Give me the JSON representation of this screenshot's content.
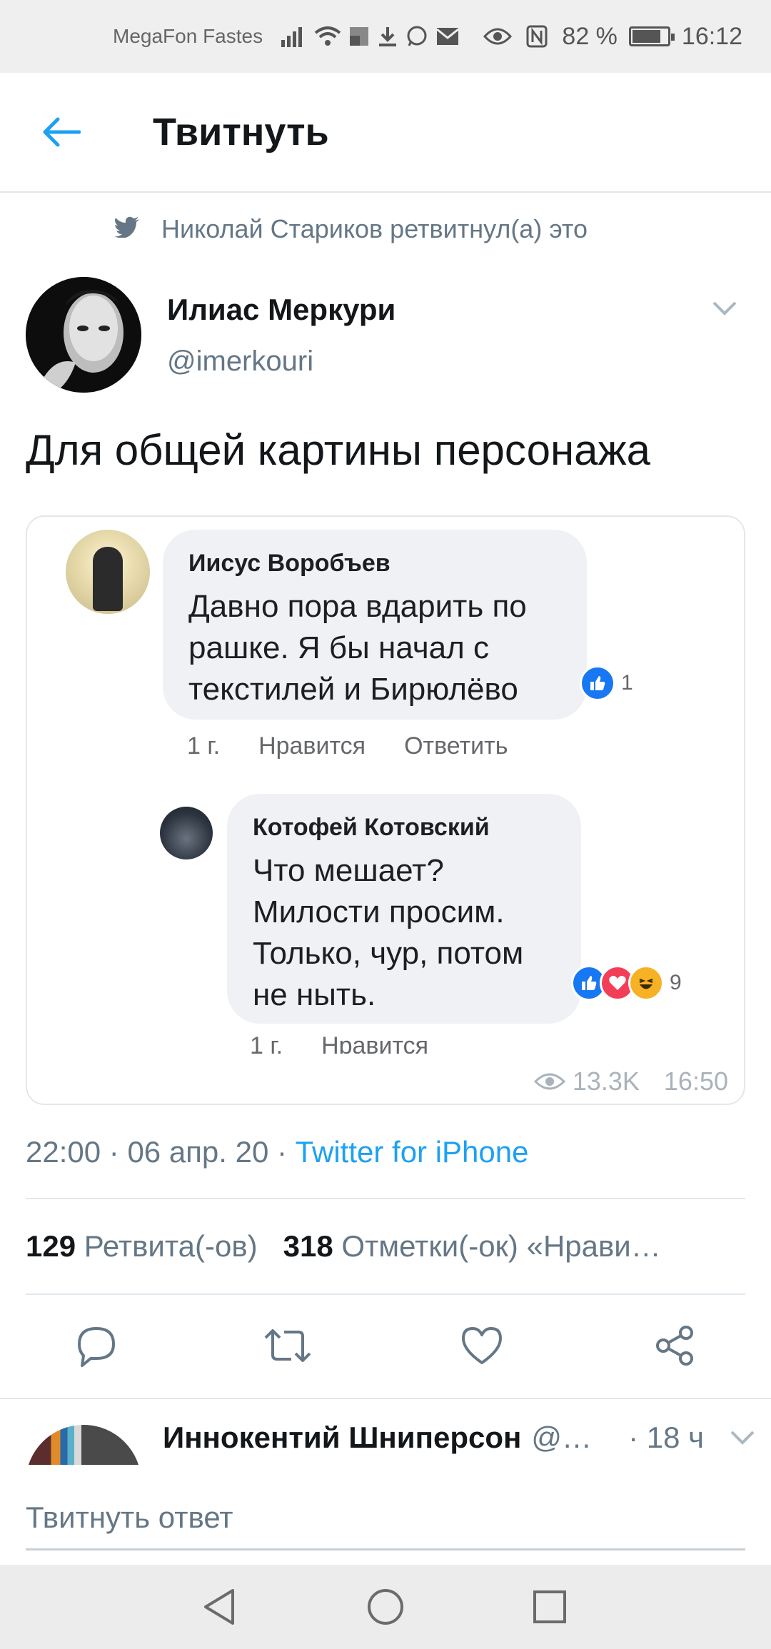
{
  "status_bar": {
    "carrier": "MegaFon Fastes",
    "battery": "82 %",
    "battery_level": 0.82,
    "time": "16:12"
  },
  "header": {
    "title": "Твитнуть"
  },
  "retweet": {
    "text": "Николай Стариков ретвитнул(а) это"
  },
  "tweet": {
    "author_name": "Илиас Меркури",
    "author_handle": "@imerkouri",
    "text": "Для общей картины персонажа",
    "time": "22:00",
    "date": "06 апр. 20",
    "source": "Twitter for iPhone",
    "retweets_count": "129",
    "retweets_label": "Ретвита(-ов)",
    "likes_count": "318",
    "likes_label": "Отметки(-ок) «Нрави…"
  },
  "media": {
    "comment1": {
      "name": "Иисус Воробъев",
      "text": "Давно пора вдарить по рашке. Я бы начал с текстилей и Бирюлёво",
      "reactions": "1",
      "age": "1 г.",
      "like": "Нравится",
      "reply": "Ответить"
    },
    "comment2": {
      "name": "Котофей Котовский",
      "text": "Что мешает? Милости просим. Только, чур, потом не ныть.",
      "reactions": "9",
      "age": "1 г.",
      "like": "Нравится"
    },
    "views": "13.3K",
    "time": "16:50"
  },
  "reply_preview": {
    "name": "Иннокентий Шниперсон",
    "handle": "@…",
    "time": "· 18 ч"
  },
  "compose": {
    "placeholder": "Твитнуть ответ"
  },
  "colors": {
    "accent": "#1da1f2",
    "text": "#14171a",
    "secondary": "#657786"
  }
}
